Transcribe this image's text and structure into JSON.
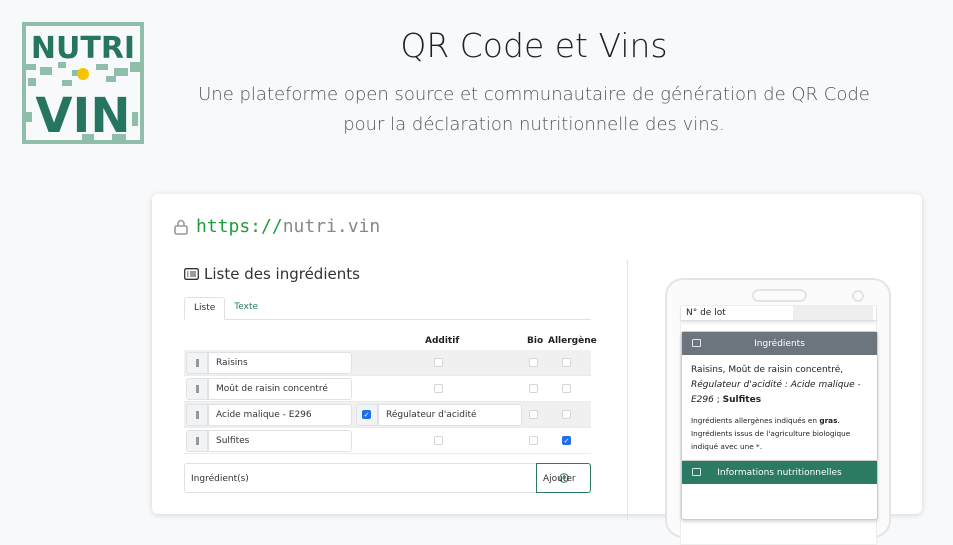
{
  "logo": {
    "line1": "NUTRI",
    "line2": "VIN"
  },
  "header": {
    "title": "QR Code et Vins",
    "subtitle_line1": "Une plateforme open source et communautaire de génération de QR Code",
    "subtitle_line2": "pour la déclaration nutritionnelle des vins."
  },
  "browser": {
    "url_scheme": "https://",
    "url_host": "nutri.vin",
    "lock_icon": "lock-icon"
  },
  "editor": {
    "title": "Liste des ingrédients",
    "tabs": [
      {
        "label": "Liste",
        "active": true
      },
      {
        "label": "Texte",
        "active": false
      }
    ],
    "columns": {
      "additif": "Additif",
      "bio": "Bio",
      "allergene": "Allergène"
    },
    "rows": [
      {
        "name": "Raisins",
        "additif": false,
        "bio": false,
        "allergene": false
      },
      {
        "name": "Moût de raisin concentré",
        "additif": false,
        "bio": false,
        "allergene": false
      },
      {
        "name": "Acide malique - E296",
        "additif": true,
        "additif_label": "Régulateur d'acidité",
        "bio": false,
        "allergene": false
      },
      {
        "name": "Sulfites",
        "additif": false,
        "bio": false,
        "allergene": true
      }
    ],
    "new_ingredient_placeholder": "Ingrédient(s)",
    "add_button": "Ajouter"
  },
  "phone": {
    "lot_label": "N° de lot",
    "ingredients_card": {
      "title": "Ingrédients",
      "text_plain": "Raisins, Moût de raisin concentré, ",
      "text_italic": "Régulateur d'acidité : Acide malique - E296",
      "text_sep": " ; ",
      "text_bold": "Sulfites",
      "note1_prefix": "Ingrédients allergènes indiqués en ",
      "note1_bold": "gras",
      "note1_suffix": ".",
      "note2": "Ingrédients issus de l'agriculture biologique indiqué avec une *."
    },
    "nutrition_card": {
      "title": "Informations nutritionnelles"
    }
  },
  "colors": {
    "brand_green": "#2a7a64",
    "light_green": "#8fbfab",
    "yellow": "#f5c400",
    "gray_header": "#6c757d",
    "url_green": "#1f9d3e"
  }
}
